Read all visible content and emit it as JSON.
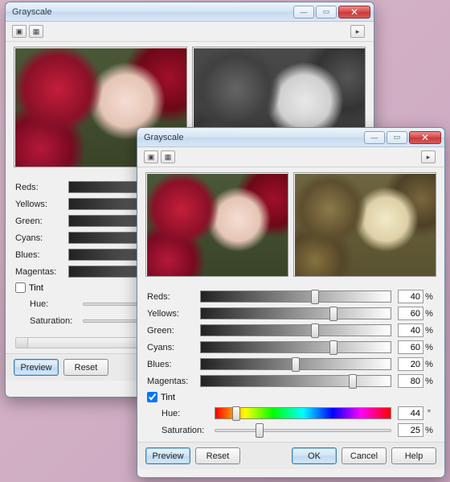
{
  "back": {
    "title": "Grayscale",
    "sliders": [
      {
        "label": "Reds:"
      },
      {
        "label": "Yellows:"
      },
      {
        "label": "Green:"
      },
      {
        "label": "Cyans:"
      },
      {
        "label": "Blues:"
      },
      {
        "label": "Magentas:"
      }
    ],
    "tint": {
      "label": "Tint",
      "checked": false,
      "hue_label": "Hue:",
      "sat_label": "Saturation:"
    },
    "buttons": {
      "preview": "Preview",
      "reset": "Reset"
    }
  },
  "front": {
    "title": "Grayscale",
    "sliders": [
      {
        "label": "Reds:",
        "value": 40,
        "unit": "%"
      },
      {
        "label": "Yellows:",
        "value": 60,
        "unit": "%"
      },
      {
        "label": "Green:",
        "value": 40,
        "unit": "%"
      },
      {
        "label": "Cyans:",
        "value": 60,
        "unit": "%"
      },
      {
        "label": "Blues:",
        "value": 20,
        "unit": "%"
      },
      {
        "label": "Magentas:",
        "value": 80,
        "unit": "%"
      }
    ],
    "tint": {
      "label": "Tint",
      "checked": true,
      "hue_label": "Hue:",
      "hue_value": 44,
      "hue_unit": "°",
      "sat_label": "Saturation:",
      "sat_value": 25,
      "sat_unit": "%"
    },
    "buttons": {
      "preview": "Preview",
      "reset": "Reset",
      "ok": "OK",
      "cancel": "Cancel",
      "help": "Help"
    }
  }
}
